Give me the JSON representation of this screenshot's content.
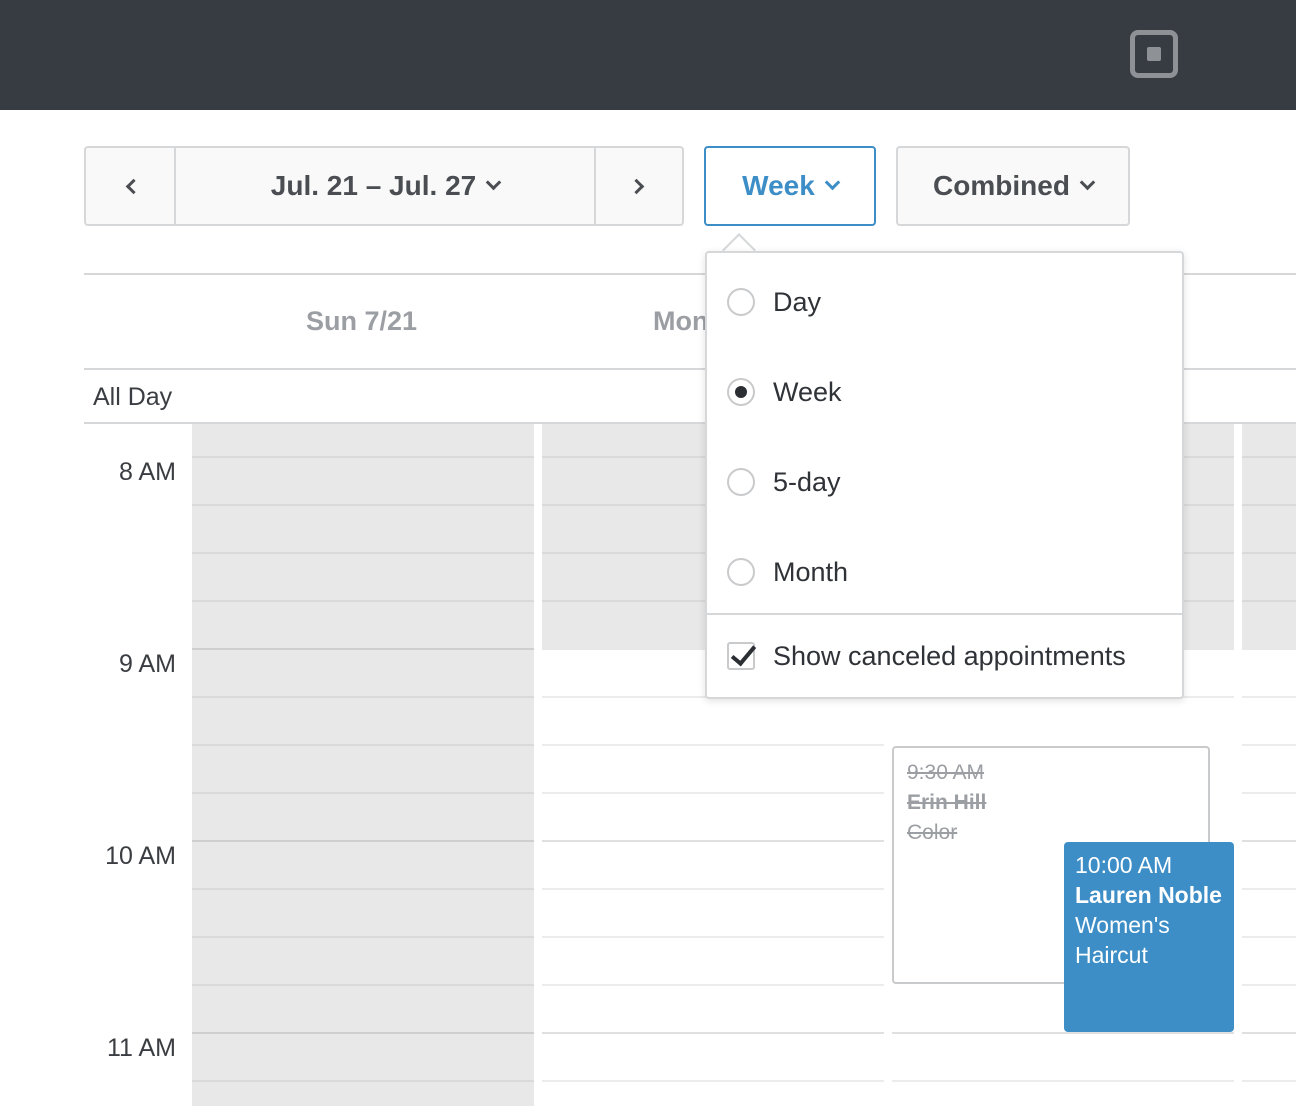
{
  "toolbar": {
    "date_range": "Jul. 21 – Jul. 27",
    "view_label": "Week",
    "calendar_mode": "Combined"
  },
  "calendar": {
    "days": [
      "Sun 7/21",
      "Mon"
    ],
    "all_day_label": "All Day",
    "hours": [
      "8 AM",
      "9 AM",
      "10 AM",
      "11 AM"
    ]
  },
  "view_menu": {
    "options": [
      {
        "label": "Day",
        "selected": false
      },
      {
        "label": "Week",
        "selected": true
      },
      {
        "label": "5-day",
        "selected": false
      },
      {
        "label": "Month",
        "selected": false
      }
    ],
    "show_canceled_label": "Show canceled appointments",
    "show_canceled_checked": true
  },
  "appointments": [
    {
      "time": "9:30 AM",
      "client": "Erin Hill",
      "service": "Color",
      "canceled": true
    },
    {
      "time": "10:00 AM",
      "client": "Lauren Noble",
      "service": "Women's Haircut",
      "canceled": false,
      "color": "#3d8ec7"
    }
  ],
  "colors": {
    "topbar": "#373b42",
    "accent": "#3d8ec7"
  }
}
